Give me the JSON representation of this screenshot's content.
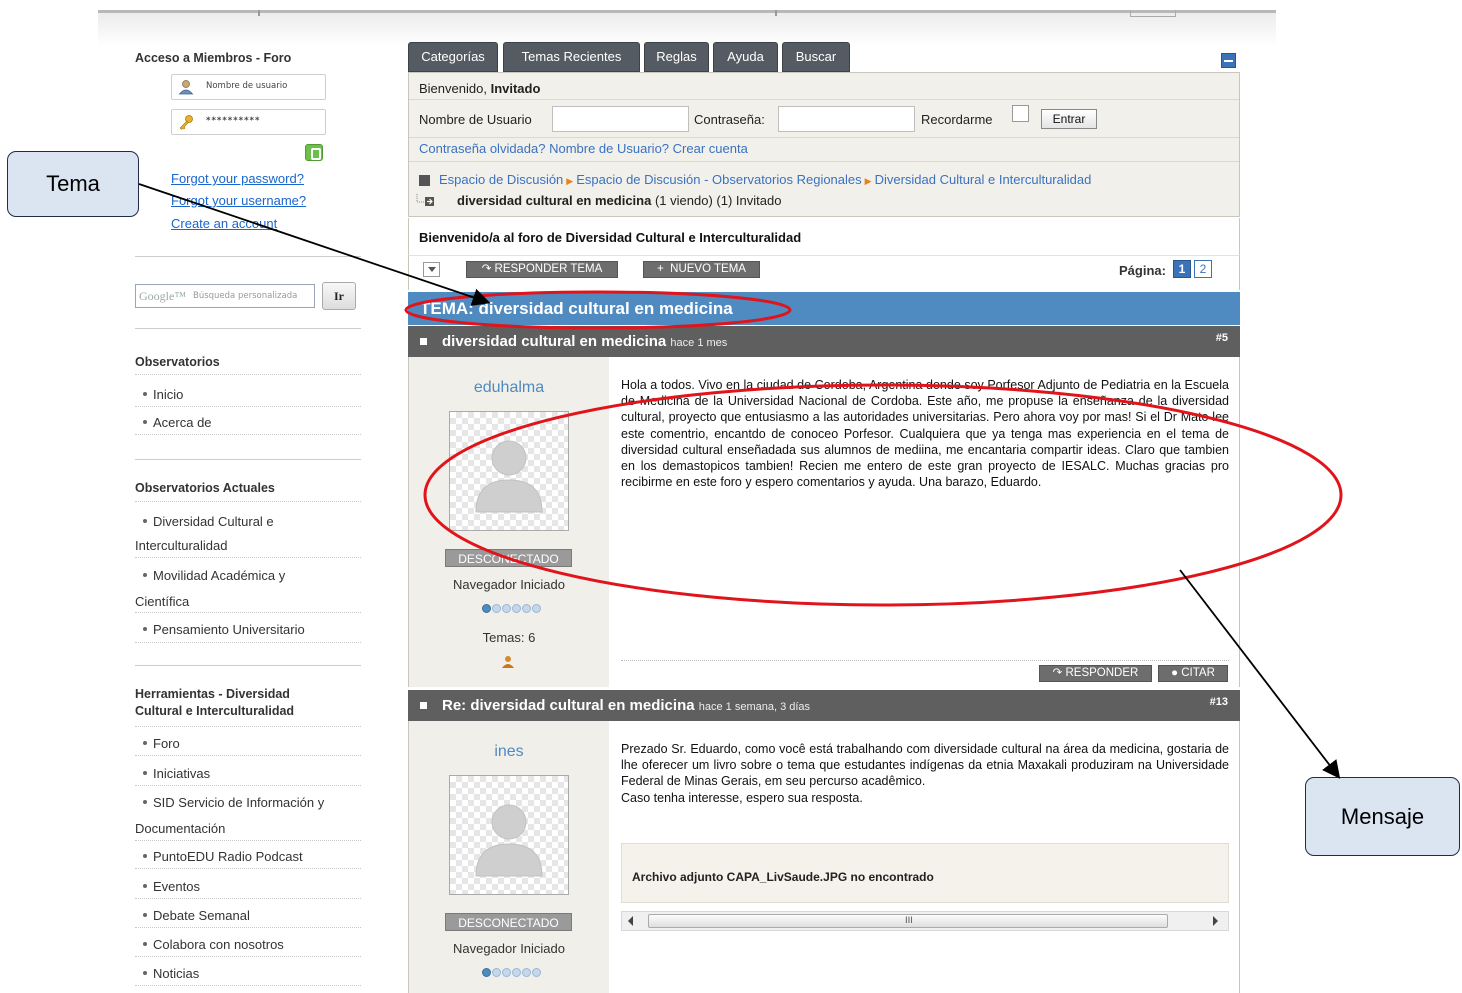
{
  "sidebar": {
    "login_title": "Acceso a Miembros - Foro",
    "username_placeholder": "Nombre de usuario",
    "password_mask": "**********",
    "forgot_password": "Forgot your password?",
    "forgot_username": "Forgot your username?",
    "create_account": "Create an account",
    "search_placeholder": "Búsqueda personalizada",
    "search_brand": "Google™",
    "search_button": "Ir",
    "sections": [
      {
        "title": "Observatorios",
        "items": [
          "Inicio",
          "Acerca de"
        ]
      },
      {
        "title": "Observatorios Actuales",
        "items": [
          "Diversidad Cultural e",
          "Interculturalidad",
          "Movilidad Académica y",
          "Científica",
          "Pensamiento Universitario"
        ]
      },
      {
        "title_line1": "Herramientas - Diversidad",
        "title_line2": "Cultural e Interculturalidad",
        "items": [
          "Foro",
          "Iniciativas",
          "SID Servicio de Información y",
          "Documentación",
          "PuntoEDU Radio Podcast",
          "Eventos",
          "Debate Semanal",
          "Colabora con nosotros",
          "Noticias"
        ]
      }
    ]
  },
  "tabs": [
    "Categorías",
    "Temas Recientes",
    "Reglas",
    "Ayuda",
    "Buscar"
  ],
  "login_bar": {
    "welcome_prefix": "Bienvenido,",
    "welcome_user": "Invitado",
    "username_label": "Nombre de Usuario",
    "password_label": "Contraseña:",
    "remember_label": "Recordarme",
    "enter_button": "Entrar",
    "links": "Contraseña olvidada? Nombre de Usuario? Crear cuenta"
  },
  "breadcrumb": {
    "items": [
      "Espacio de Discusión",
      "Espacio de Discusión - Observatorios Regionales",
      "Diversidad Cultural e Interculturalidad"
    ],
    "topic": "diversidad cultural en medicina",
    "viewing": "(1 viendo) (1) Invitado"
  },
  "welcome_text": "Bienvenido/a al foro de Diversidad Cultural e Interculturalidad",
  "actions": {
    "reply_topic": "RESPONDER TEMA",
    "new_topic": "NUEVO TEMA",
    "page_label": "Página:",
    "pages": [
      "1",
      "2"
    ]
  },
  "topic_title": "TEMA: diversidad cultural en medicina",
  "posts": [
    {
      "title": "diversidad cultural en medicina",
      "ago": "hace 1 mes",
      "number": "#5",
      "user": "eduhalma",
      "status": "DESCONECTADO",
      "rank": "Navegador Iniciado",
      "topics": "Temas: 6",
      "rank_dots_filled": 1,
      "rank_dots_total": 6,
      "message": "Hola a todos. Vivo en la ciudad de Cordoba, Argentina donde soy Porfesor Adjunto de Pediatria en la Escuela de Medicina de la Universidad Nacional de Cordoba. Este año, me propuse la enseñanza de la diversidad cultural, proyecto que entusiasmo a las autoridades universitarias. Pero ahora voy por mas! Si el Dr Mato lee este comentrio, encantdo de conoceo Porfesor. Cualquiera que ya tenga mas experiencia en el tema de diversidad cultural enseñadada sus alumnos de mediina, me encantaria compartir ideas. Claro que tambien en los demastopicos tambien! Recien me entero de este gran proyecto de IESALC. Muchas gracias pro recibirme en este foro y espero comentarios y ayuda. Una barazo, Eduardo.",
      "reply_button": "RESPONDER",
      "quote_button": "CITAR"
    },
    {
      "title": "Re: diversidad cultural en medicina",
      "ago": "hace 1 semana, 3 días",
      "number": "#13",
      "user": "ines",
      "status": "DESCONECTADO",
      "rank": "Navegador Iniciado",
      "rank_dots_filled": 1,
      "rank_dots_total": 6,
      "message_p1": "Prezado Sr. Eduardo, como você está trabalhando com diversidade cultural na área da medicina, gostaria de lhe oferecer um livro sobre o tema que estudantes indígenas da etnia Maxakali produziram na Universidade Federal de Minas Gerais, em seu percurso acadêmico.",
      "message_p2": "Caso tenha interesse, espero sua resposta.",
      "attachment": "Archivo adjunto CAPA_LivSaude.JPG no encontrado",
      "scroll_grip": "III"
    }
  ],
  "annotations": {
    "tema": "Tema",
    "mensaje": "Mensaje"
  },
  "colors": {
    "topic_bar": "#4f8ac0",
    "post_header": "#5f5f5f",
    "tab": "#555b63",
    "link": "#3a72c0",
    "highlight_ellipse": "#e0141a"
  }
}
